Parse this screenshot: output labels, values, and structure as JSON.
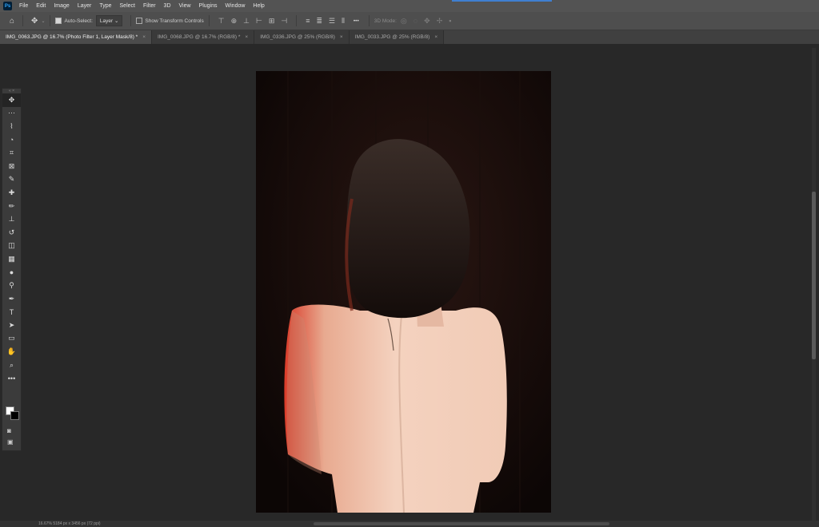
{
  "menu": {
    "app_logo": "Ps",
    "items": [
      "File",
      "Edit",
      "Image",
      "Layer",
      "Type",
      "Select",
      "Filter",
      "3D",
      "View",
      "Plugins",
      "Window",
      "Help"
    ]
  },
  "options": {
    "auto_select_label": "Auto-Select:",
    "auto_select_checked": true,
    "layer_dropdown": "Layer",
    "show_transform_label": "Show Transform Controls",
    "show_transform_checked": false,
    "mode_3d_label": "3D Mode:",
    "more_label": "•••"
  },
  "tabs": [
    {
      "label": "IMG_0063.JPG @ 16.7% (Photo Filter 1, Layer Mask/8) *",
      "active": true
    },
    {
      "label": "IMG_0068.JPG @ 16.7% (RGB/8) *",
      "active": false
    },
    {
      "label": "IMG_0336.JPG @ 25% (RGB/8)",
      "active": false
    },
    {
      "label": "IMG_0033.JPG @ 25% (RGB/8)",
      "active": false
    }
  ],
  "tab_close_glyph": "×",
  "tools": [
    "move-tool",
    "artboard-more",
    "lasso-tool",
    "quick-selection-tool",
    "crop-tool",
    "frame-tool",
    "eyedropper-tool",
    "spot-healing-tool",
    "brush-tool",
    "clone-stamp-tool",
    "history-brush-tool",
    "eraser-tool",
    "gradient-tool",
    "blur-tool",
    "dodge-tool",
    "pen-tool",
    "type-tool",
    "path-selection-tool",
    "rectangle-tool",
    "hand-tool",
    "zoom-tool",
    "more-tools"
  ],
  "tool_glyphs": [
    "✥",
    "⋯",
    "⌇",
    "◔",
    "⌗",
    "⊠",
    "✎",
    "✚",
    "✏",
    "⊥",
    "↺",
    "◫",
    "▦",
    "●",
    "⚲",
    "✒",
    "T",
    "➤",
    "▭",
    "✋",
    "⌕",
    "•••"
  ],
  "colors": {
    "foreground": "#ffffff",
    "background": "#000000"
  },
  "status": {
    "text": "16.67%   5184 px x 3456 px (72 ppi)"
  }
}
